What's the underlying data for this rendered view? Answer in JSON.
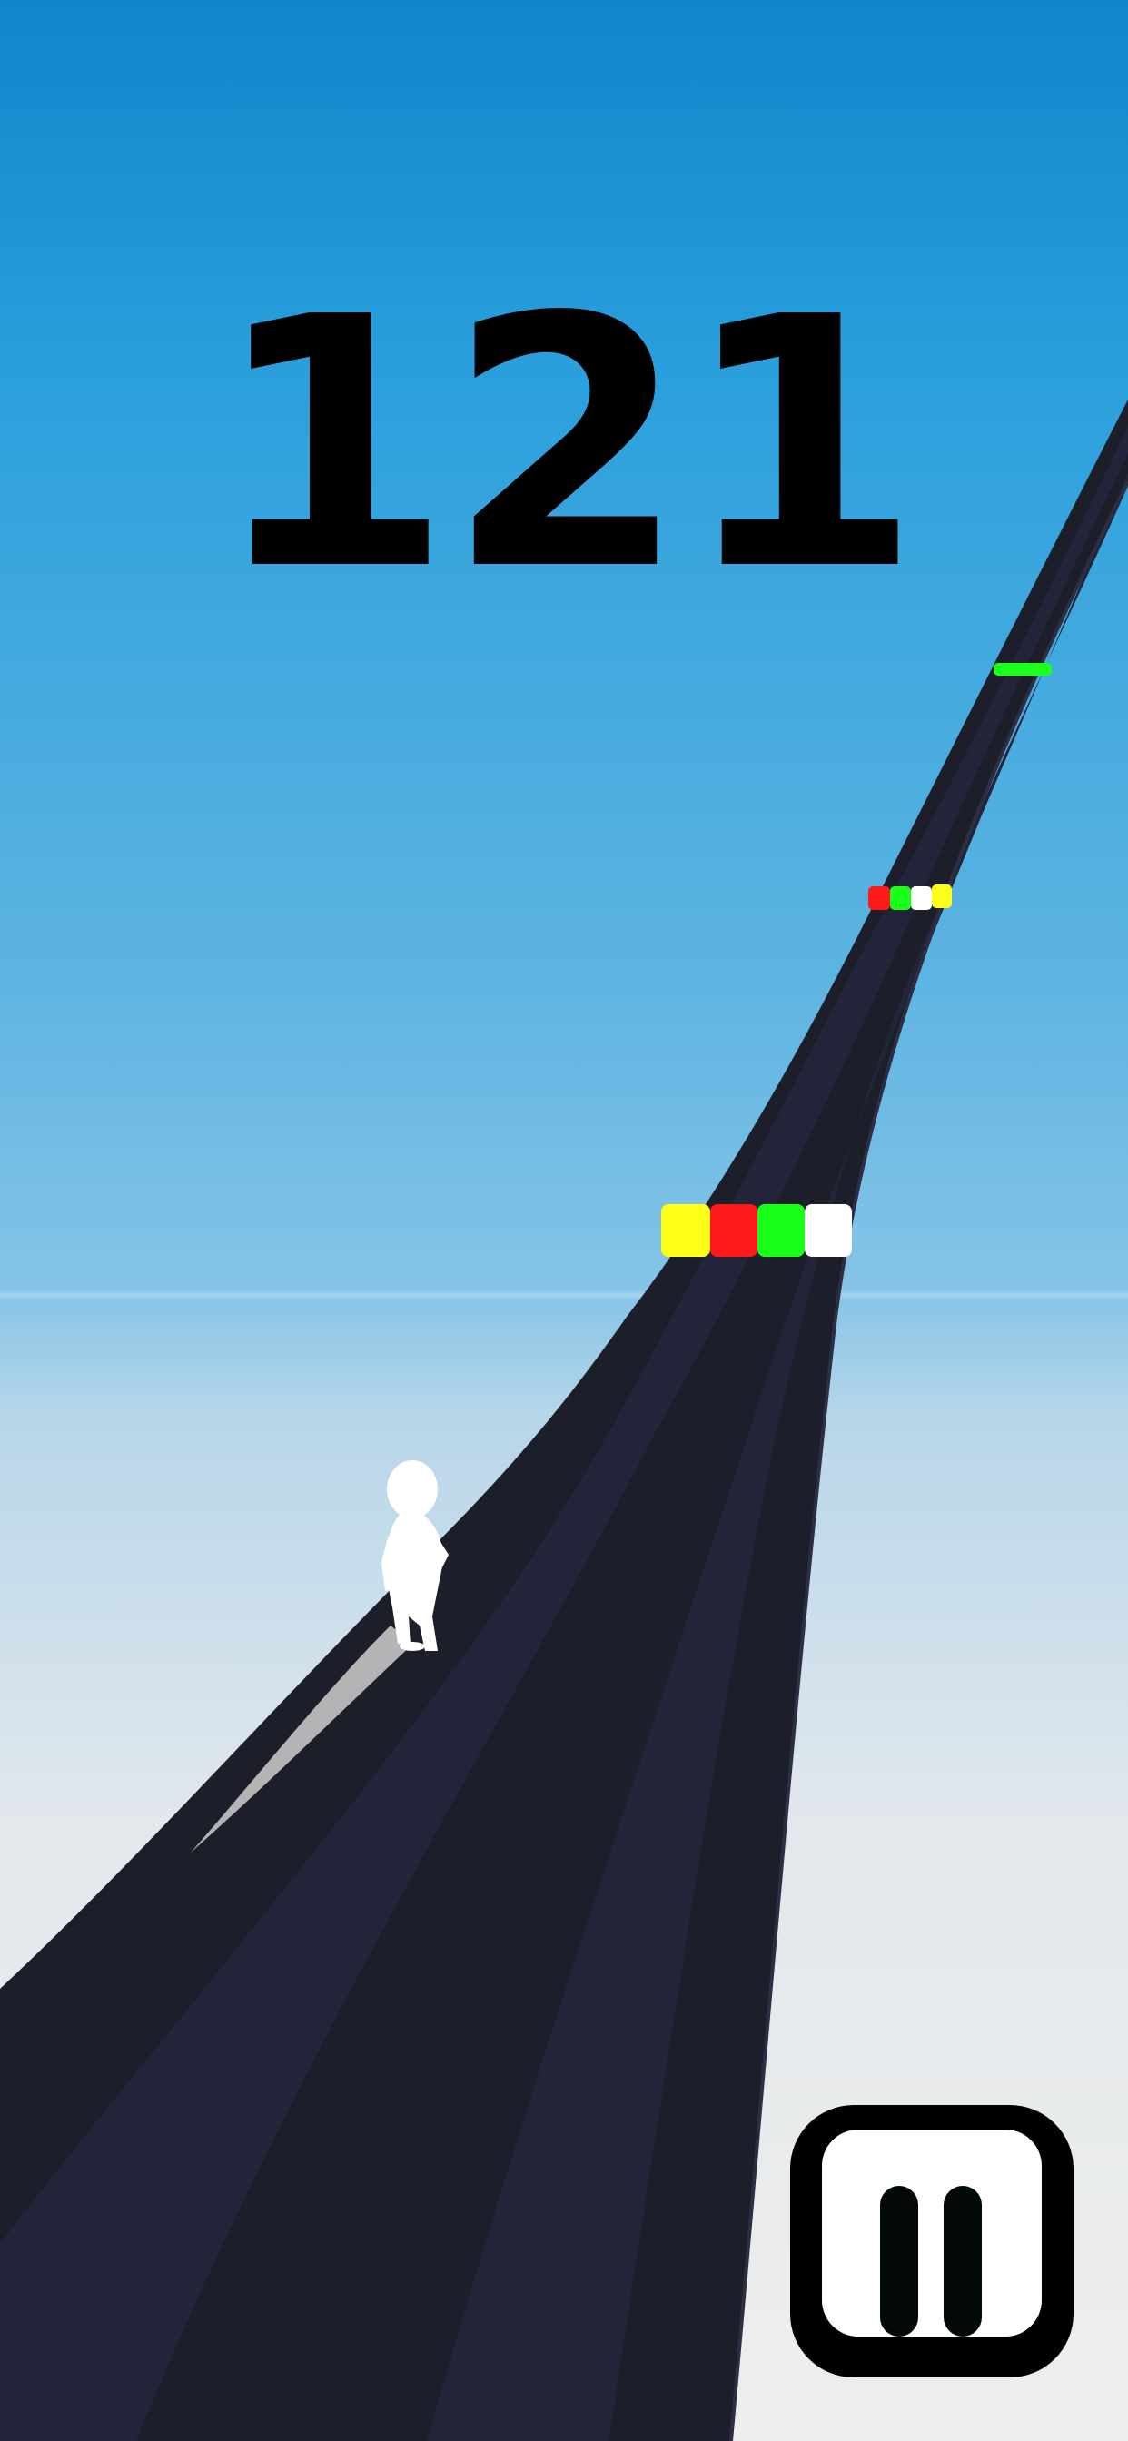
{
  "hud": {
    "score": "121"
  },
  "controls": {
    "pause_icon": "pause-icon"
  },
  "colors": {
    "track_dark": "#1b1d27",
    "track_lane": "#232438",
    "gate_yellow": "#ffff1a",
    "gate_red": "#ff1a1a",
    "gate_green": "#1aff1a",
    "gate_white": "#ffffff",
    "runner": "#ffffff"
  },
  "gates": [
    {
      "position": "near",
      "tiles": [
        "yellow",
        "red",
        "green",
        "white"
      ]
    },
    {
      "position": "middle",
      "tiles": [
        "red",
        "green",
        "white",
        "yellow"
      ]
    },
    {
      "position": "far",
      "tiles": [
        "green"
      ]
    }
  ]
}
